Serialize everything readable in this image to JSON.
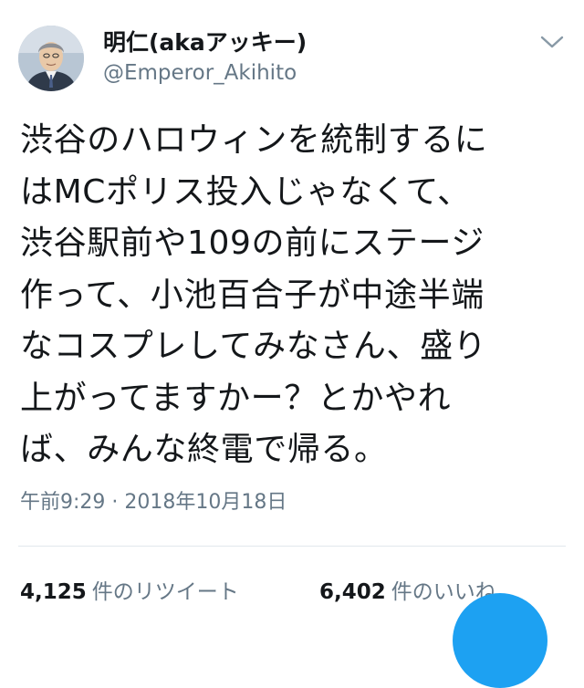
{
  "tweet": {
    "author": {
      "display_name": "明仁(akaアッキー)",
      "handle": "@Emperor_Akihito",
      "avatar_icon": "user-avatar-icon"
    },
    "menu_icon": "chevron-down-icon",
    "text_lines": [
      "渋谷のハロウィンを統制するに",
      "はMCポリス投入じゃなくて、",
      "渋谷駅前や109の前にステージ",
      "作って、小池百合子が中途半端",
      "なコスプレしてみなさん、盛り",
      "上がってますかー？とかやれ",
      "ば、みんな終電で帰る。"
    ],
    "timestamp": "午前9:29 · 2018年10月18日",
    "stats": {
      "retweets_count": "4,125",
      "retweets_label": "件のリツイート",
      "likes_count": "6,402",
      "likes_label": "件のいいね"
    }
  },
  "colors": {
    "primary_text": "#14171a",
    "secondary_text": "#657786",
    "divider": "#e1e8ed",
    "accent": "#1da1f2"
  }
}
